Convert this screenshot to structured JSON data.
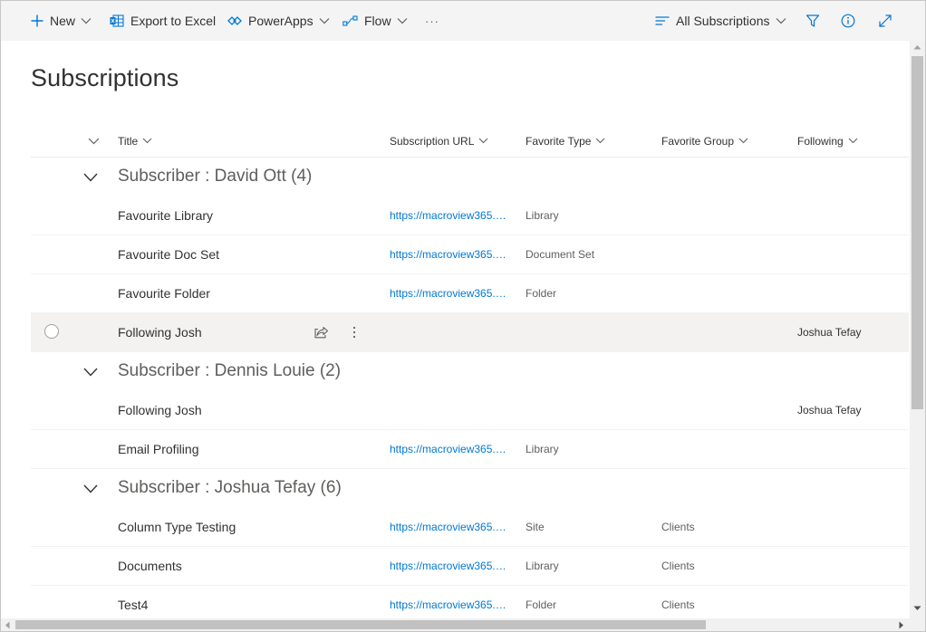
{
  "toolbar": {
    "new_label": "New",
    "export_label": "Export to Excel",
    "powerapps_label": "PowerApps",
    "flow_label": "Flow",
    "more_label": "···",
    "view_label": "All Subscriptions"
  },
  "page": {
    "title": "Subscriptions"
  },
  "columns": {
    "title": "Title",
    "url": "Subscription URL",
    "type": "Favorite Type",
    "group": "Favorite Group",
    "following": "Following"
  },
  "groups": [
    {
      "label": "Subscriber : David Ott (4)",
      "rows": [
        {
          "title": "Favourite Library",
          "url": "https://macroview365.sharepoint.com",
          "type": "Library",
          "group": "",
          "following": ""
        },
        {
          "title": "Favourite Doc Set",
          "url": "https://macroview365.sharepoint.com",
          "type": "Document Set",
          "group": "",
          "following": ""
        },
        {
          "title": "Favourite Folder",
          "url": "https://macroview365.sharepoint.com",
          "type": "Folder",
          "group": "",
          "following": ""
        },
        {
          "title": "Following Josh",
          "url": "",
          "type": "",
          "group": "",
          "following": "Joshua Tefay"
        }
      ]
    },
    {
      "label": "Subscriber : Dennis Louie (2)",
      "rows": [
        {
          "title": "Following Josh",
          "url": "",
          "type": "",
          "group": "",
          "following": "Joshua Tefay"
        },
        {
          "title": "Email Profiling",
          "url": "https://macroview365.sharepoint.com",
          "type": "Library",
          "group": "",
          "following": ""
        }
      ]
    },
    {
      "label": "Subscriber : Joshua Tefay (6)",
      "rows": [
        {
          "title": "Column Type Testing",
          "url": "https://macroview365.sharepoint.com",
          "type": "Site",
          "group": "Clients",
          "following": ""
        },
        {
          "title": "Documents",
          "url": "https://macroview365.sharepoint.com",
          "type": "Library",
          "group": "Clients",
          "following": ""
        },
        {
          "title": "Test4",
          "url": "https://macroview365.sharepoint.com",
          "type": "Folder",
          "group": "Clients",
          "following": ""
        }
      ]
    }
  ],
  "colors": {
    "accent": "#0078d4",
    "selected_row": "#f3f2f1",
    "toolbar_bg": "#f4f4f4"
  }
}
